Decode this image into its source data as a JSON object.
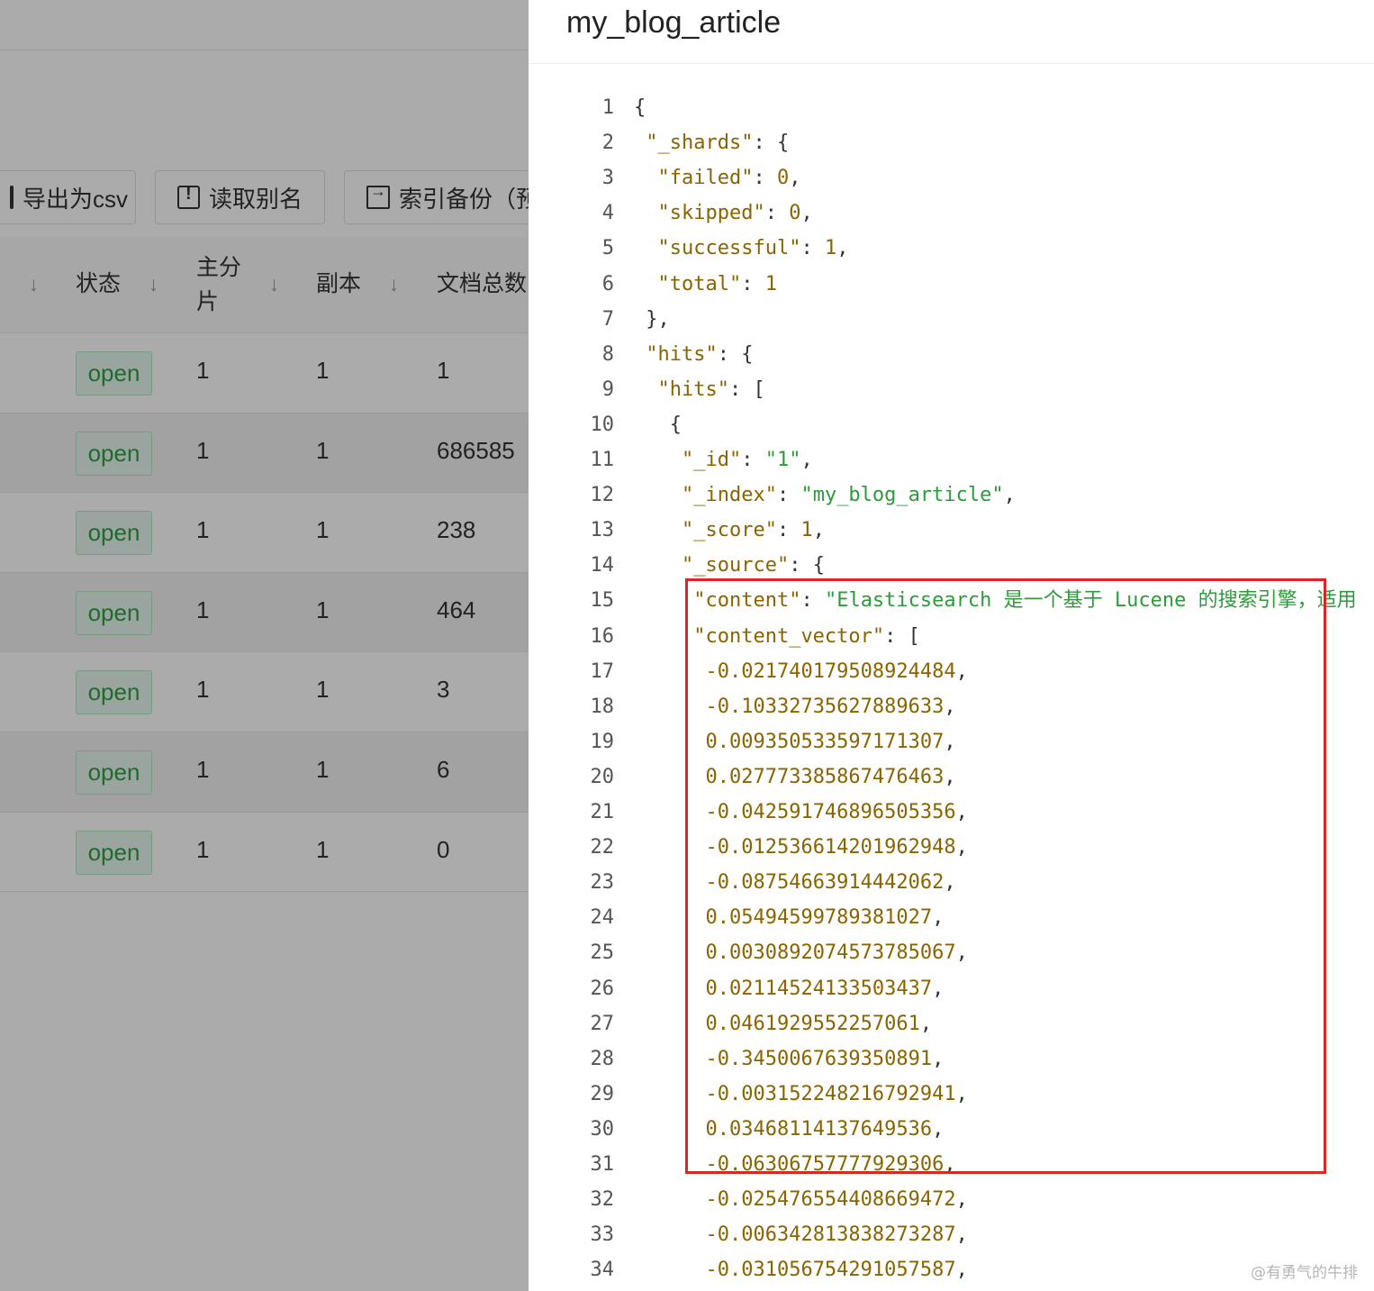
{
  "toolbar": {
    "export_csv": "导出为csv",
    "read_alias": "读取别名",
    "index_backup": "索引备份（预"
  },
  "table": {
    "headers": {
      "status": "状态",
      "primary_shards_line1": "主分",
      "primary_shards_line2": "片",
      "replicas": "副本",
      "doc_count": "文档总数"
    },
    "rows": [
      {
        "status": "open",
        "primary": "1",
        "replicas": "1",
        "docs": "1"
      },
      {
        "status": "open",
        "primary": "1",
        "replicas": "1",
        "docs": "686585"
      },
      {
        "status": "open",
        "primary": "1",
        "replicas": "1",
        "docs": "238"
      },
      {
        "status": "open",
        "primary": "1",
        "replicas": "1",
        "docs": "464"
      },
      {
        "status": "open",
        "primary": "1",
        "replicas": "1",
        "docs": "3"
      },
      {
        "status": "open",
        "primary": "1",
        "replicas": "1",
        "docs": "6"
      },
      {
        "status": "open",
        "primary": "1",
        "replicas": "1",
        "docs": "0"
      }
    ]
  },
  "drawer": {
    "title": "my_blog_article",
    "lines": [
      {
        "num": "1",
        "indent": "",
        "parts": [
          {
            "t": "{",
            "c": "p"
          }
        ]
      },
      {
        "num": "2",
        "indent": " ",
        "parts": [
          {
            "t": "\"_shards\"",
            "c": "k"
          },
          {
            "t": ": {",
            "c": "p"
          }
        ]
      },
      {
        "num": "3",
        "indent": "  ",
        "parts": [
          {
            "t": "\"failed\"",
            "c": "k"
          },
          {
            "t": ": ",
            "c": "p"
          },
          {
            "t": "0",
            "c": "n"
          },
          {
            "t": ",",
            "c": "p"
          }
        ]
      },
      {
        "num": "4",
        "indent": "  ",
        "parts": [
          {
            "t": "\"skipped\"",
            "c": "k"
          },
          {
            "t": ": ",
            "c": "p"
          },
          {
            "t": "0",
            "c": "n"
          },
          {
            "t": ",",
            "c": "p"
          }
        ]
      },
      {
        "num": "5",
        "indent": "  ",
        "parts": [
          {
            "t": "\"successful\"",
            "c": "k"
          },
          {
            "t": ": ",
            "c": "p"
          },
          {
            "t": "1",
            "c": "n"
          },
          {
            "t": ",",
            "c": "p"
          }
        ]
      },
      {
        "num": "6",
        "indent": "  ",
        "parts": [
          {
            "t": "\"total\"",
            "c": "k"
          },
          {
            "t": ": ",
            "c": "p"
          },
          {
            "t": "1",
            "c": "n"
          }
        ]
      },
      {
        "num": "7",
        "indent": " ",
        "parts": [
          {
            "t": "},",
            "c": "p"
          }
        ]
      },
      {
        "num": "8",
        "indent": " ",
        "parts": [
          {
            "t": "\"hits\"",
            "c": "k"
          },
          {
            "t": ": {",
            "c": "p"
          }
        ]
      },
      {
        "num": "9",
        "indent": "  ",
        "parts": [
          {
            "t": "\"hits\"",
            "c": "k"
          },
          {
            "t": ": [",
            "c": "p"
          }
        ]
      },
      {
        "num": "10",
        "indent": "   ",
        "parts": [
          {
            "t": "{",
            "c": "p"
          }
        ]
      },
      {
        "num": "11",
        "indent": "    ",
        "parts": [
          {
            "t": "\"_id\"",
            "c": "k"
          },
          {
            "t": ": ",
            "c": "p"
          },
          {
            "t": "\"1\"",
            "c": "s"
          },
          {
            "t": ",",
            "c": "p"
          }
        ]
      },
      {
        "num": "12",
        "indent": "    ",
        "parts": [
          {
            "t": "\"_index\"",
            "c": "k"
          },
          {
            "t": ": ",
            "c": "p"
          },
          {
            "t": "\"my_blog_article\"",
            "c": "s"
          },
          {
            "t": ",",
            "c": "p"
          }
        ]
      },
      {
        "num": "13",
        "indent": "    ",
        "parts": [
          {
            "t": "\"_score\"",
            "c": "k"
          },
          {
            "t": ": ",
            "c": "p"
          },
          {
            "t": "1",
            "c": "n"
          },
          {
            "t": ",",
            "c": "p"
          }
        ]
      },
      {
        "num": "14",
        "indent": "    ",
        "parts": [
          {
            "t": "\"_source\"",
            "c": "k"
          },
          {
            "t": ": {",
            "c": "p"
          }
        ]
      },
      {
        "num": "15",
        "indent": "     ",
        "parts": [
          {
            "t": "\"content\"",
            "c": "k"
          },
          {
            "t": ": ",
            "c": "p"
          },
          {
            "t": "\"Elasticsearch 是一个基于 Lucene 的搜索引擎，适用",
            "c": "s"
          }
        ]
      },
      {
        "num": "16",
        "indent": "     ",
        "parts": [
          {
            "t": "\"content_vector\"",
            "c": "k"
          },
          {
            "t": ": [",
            "c": "p"
          }
        ]
      },
      {
        "num": "17",
        "indent": "      ",
        "parts": [
          {
            "t": "-0.021740179508924484",
            "c": "n"
          },
          {
            "t": ",",
            "c": "p"
          }
        ]
      },
      {
        "num": "18",
        "indent": "      ",
        "parts": [
          {
            "t": "-0.10332735627889633",
            "c": "n"
          },
          {
            "t": ",",
            "c": "p"
          }
        ]
      },
      {
        "num": "19",
        "indent": "      ",
        "parts": [
          {
            "t": "0.009350533597171307",
            "c": "n"
          },
          {
            "t": ",",
            "c": "p"
          }
        ]
      },
      {
        "num": "20",
        "indent": "      ",
        "parts": [
          {
            "t": "0.027773385867476463",
            "c": "n"
          },
          {
            "t": ",",
            "c": "p"
          }
        ]
      },
      {
        "num": "21",
        "indent": "      ",
        "parts": [
          {
            "t": "-0.042591746896505356",
            "c": "n"
          },
          {
            "t": ",",
            "c": "p"
          }
        ]
      },
      {
        "num": "22",
        "indent": "      ",
        "parts": [
          {
            "t": "-0.012536614201962948",
            "c": "n"
          },
          {
            "t": ",",
            "c": "p"
          }
        ]
      },
      {
        "num": "23",
        "indent": "      ",
        "parts": [
          {
            "t": "-0.08754663914442062",
            "c": "n"
          },
          {
            "t": ",",
            "c": "p"
          }
        ]
      },
      {
        "num": "24",
        "indent": "      ",
        "parts": [
          {
            "t": "0.05494599789381027",
            "c": "n"
          },
          {
            "t": ",",
            "c": "p"
          }
        ]
      },
      {
        "num": "25",
        "indent": "      ",
        "parts": [
          {
            "t": "0.0030892074573785067",
            "c": "n"
          },
          {
            "t": ",",
            "c": "p"
          }
        ]
      },
      {
        "num": "26",
        "indent": "      ",
        "parts": [
          {
            "t": "0.02114524133503437",
            "c": "n"
          },
          {
            "t": ",",
            "c": "p"
          }
        ]
      },
      {
        "num": "27",
        "indent": "      ",
        "parts": [
          {
            "t": "0.0461929552257061",
            "c": "n"
          },
          {
            "t": ",",
            "c": "p"
          }
        ]
      },
      {
        "num": "28",
        "indent": "      ",
        "parts": [
          {
            "t": "-0.3450067639350891",
            "c": "n"
          },
          {
            "t": ",",
            "c": "p"
          }
        ]
      },
      {
        "num": "29",
        "indent": "      ",
        "parts": [
          {
            "t": "-0.003152248216792941",
            "c": "n"
          },
          {
            "t": ",",
            "c": "p"
          }
        ]
      },
      {
        "num": "30",
        "indent": "      ",
        "parts": [
          {
            "t": "0.03468114137649536",
            "c": "n"
          },
          {
            "t": ",",
            "c": "p"
          }
        ]
      },
      {
        "num": "31",
        "indent": "      ",
        "parts": [
          {
            "t": "-0.06306757777929306",
            "c": "n"
          },
          {
            "t": ",",
            "c": "p"
          }
        ]
      },
      {
        "num": "32",
        "indent": "      ",
        "parts": [
          {
            "t": "-0.025476554408669472",
            "c": "n"
          },
          {
            "t": ",",
            "c": "p"
          }
        ]
      },
      {
        "num": "33",
        "indent": "      ",
        "parts": [
          {
            "t": "-0.006342813838273287",
            "c": "n"
          },
          {
            "t": ",",
            "c": "p"
          }
        ]
      },
      {
        "num": "34",
        "indent": "      ",
        "parts": [
          {
            "t": "-0.031056754291057587",
            "c": "n"
          },
          {
            "t": ",",
            "c": "p"
          }
        ]
      }
    ]
  },
  "watermark": "@有勇气的牛排",
  "colors": {
    "key": "#8a6400",
    "string": "#2e9a3c",
    "number": "#8a6400",
    "highlight": "#e02424",
    "tag_green": "#2f9e44"
  }
}
